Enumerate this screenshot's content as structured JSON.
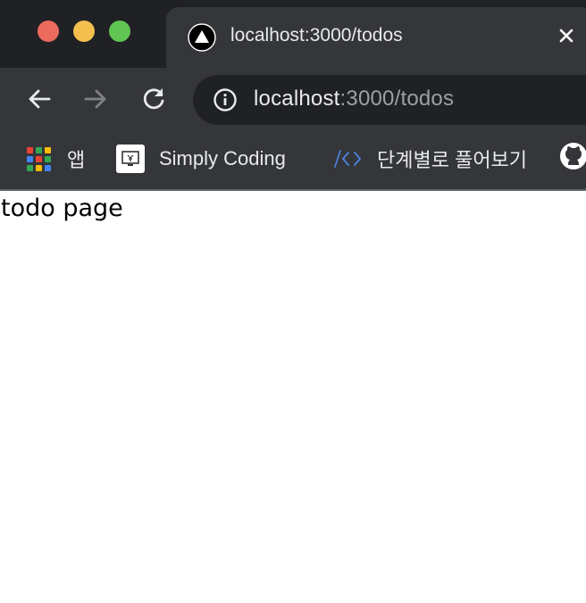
{
  "window": {
    "controls": [
      "close",
      "minimize",
      "zoom"
    ]
  },
  "tab": {
    "title": "localhost:3000/todos",
    "favicon": "triangle-icon",
    "close_icon": "close-icon"
  },
  "toolbar": {
    "back_icon": "arrow-left-icon",
    "forward_icon": "arrow-right-icon",
    "reload_icon": "reload-icon",
    "url_host": "localhost",
    "url_rest": ":3000/todos",
    "site_info_icon": "info-icon"
  },
  "bookmarks": {
    "items": [
      {
        "label": "앱",
        "icon": "apps-grid-icon"
      },
      {
        "label": "Simply Coding",
        "icon": "monitor-icon"
      },
      {
        "label": "단계별로 풀어보기",
        "icon": "code-brackets-icon"
      },
      {
        "label": "",
        "icon": "github-icon"
      }
    ]
  },
  "page": {
    "text": "todo page"
  },
  "colors": {
    "chrome_dark": "#202124",
    "chrome_mid": "#35363a",
    "text_light": "#e8eaed",
    "text_dim": "#9aa0a6",
    "traffic_red": "#ec6a5e",
    "traffic_yellow": "#f4bf4f",
    "traffic_green": "#61c554"
  }
}
